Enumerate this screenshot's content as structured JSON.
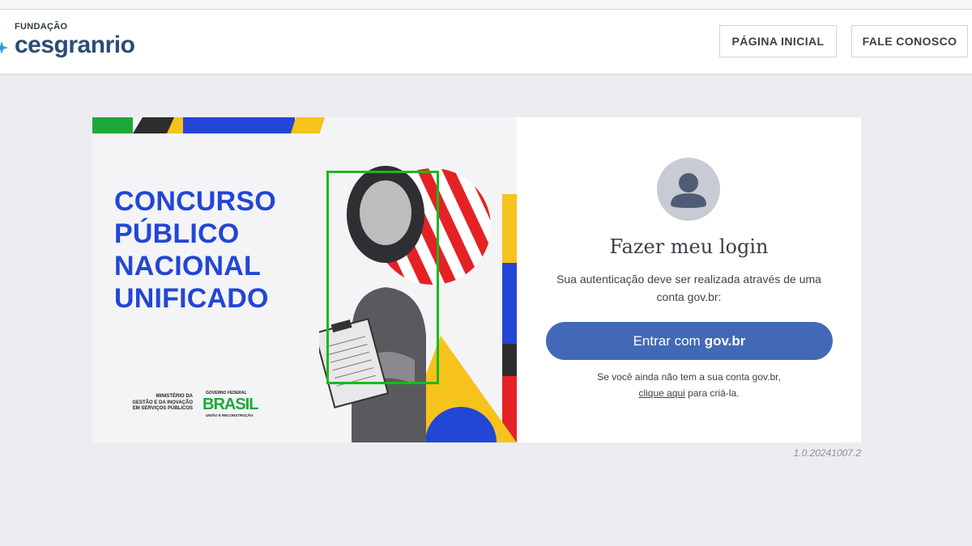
{
  "header": {
    "logo_small": "FUNDAÇÃO",
    "logo_main": "cesgranrio",
    "nav": {
      "home": "PÁGINA INICIAL",
      "contact": "FALE CONOSCO"
    }
  },
  "banner": {
    "headline": [
      "CONCURSO",
      "PÚBLICO",
      "NACIONAL",
      "UNIFICADO"
    ],
    "ministry": [
      "MINISTÉRIO DA",
      "GESTÃO E DA INOVAÇÃO",
      "EM SERVIÇOS PÚBLICOS"
    ],
    "gov_top": "GOVERNO FEDERAL",
    "gov_word": "BRASIL",
    "gov_bottom": "UNIÃO E RECONSTRUÇÃO"
  },
  "login": {
    "title": "Fazer meu login",
    "subtitle": "Sua autenticação deve ser realizada através de uma conta gov.br:",
    "button_prefix": "Entrar com",
    "button_bold": "gov.br",
    "hint_line1": "Se você ainda não tem a sua conta gov.br,",
    "hint_link": "clique aqui",
    "hint_rest": " para criá-la."
  },
  "version": "1.0.20241007.2",
  "colors": {
    "accent_blue": "#4269b7",
    "headline_blue": "#2246d6",
    "brand_navy": "#2b4c74",
    "frame_green": "#1cb81c"
  },
  "icons": {
    "avatar": "user-avatar-icon",
    "logo_mark": "cesgranrio-star-icon"
  }
}
